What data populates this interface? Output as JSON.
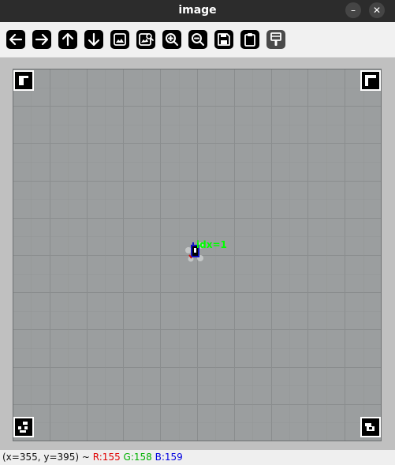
{
  "window": {
    "title": "image",
    "minimize_glyph": "–",
    "close_glyph": "✕"
  },
  "toolbar": {
    "buttons": [
      {
        "name": "pan-left",
        "icon": "arrow-left-icon"
      },
      {
        "name": "pan-right",
        "icon": "arrow-right-icon"
      },
      {
        "name": "pan-up",
        "icon": "arrow-up-icon"
      },
      {
        "name": "pan-down",
        "icon": "arrow-down-icon"
      },
      {
        "name": "zoom-fit",
        "icon": "image-icon"
      },
      {
        "name": "zoom-original",
        "icon": "image-zoom-icon"
      },
      {
        "name": "zoom-in",
        "icon": "zoom-in-icon"
      },
      {
        "name": "zoom-out",
        "icon": "zoom-out-icon"
      },
      {
        "name": "save",
        "icon": "save-icon"
      },
      {
        "name": "copy-clipboard",
        "icon": "clipboard-icon"
      },
      {
        "name": "properties",
        "icon": "paintbrush-icon"
      }
    ]
  },
  "image": {
    "robot_label": "idx=1",
    "colors": {
      "field": "#9b9e9f",
      "grid": "#8a8d8f",
      "label": "#00ff00",
      "marker_black": "#000000",
      "robot_blue": "#1010c0",
      "robot_red": "#d01010"
    }
  },
  "status": {
    "coords": "(x=355, y=395) ~ ",
    "r": "R:155",
    "g": "G:158",
    "b": "B:159"
  }
}
